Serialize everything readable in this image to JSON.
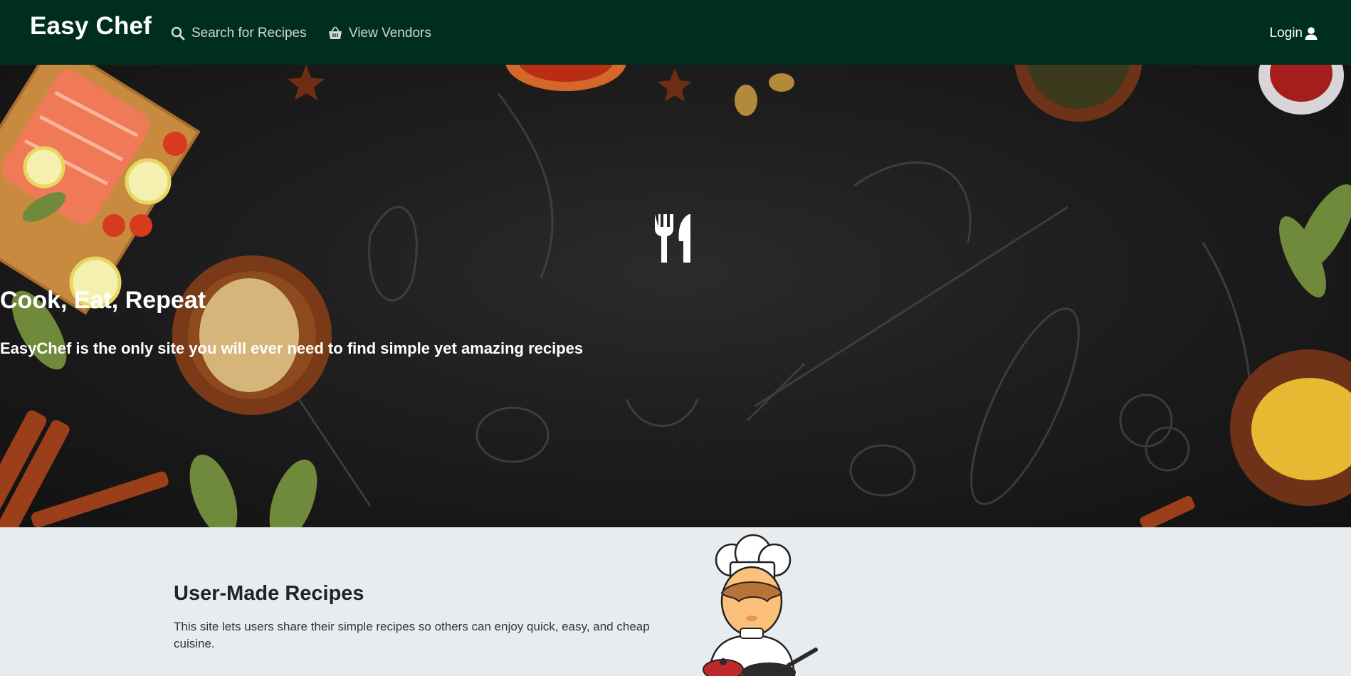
{
  "navbar": {
    "brand": "Easy Chef",
    "links": [
      {
        "label": "Search for Recipes",
        "icon": "search-icon"
      },
      {
        "label": "View Vendors",
        "icon": "basket-icon"
      }
    ],
    "login": {
      "label": "Login",
      "icon": "user-icon"
    }
  },
  "hero": {
    "icon": "utensils-icon",
    "title": "Cook, Eat, Repeat",
    "subtitle": "EasyChef is the only site you will ever need to find simple yet amazing recipes"
  },
  "section": {
    "title": "User-Made Recipes",
    "text": "This site lets users share their simple recipes so others can enjoy quick, easy, and cheap cuisine.",
    "illustration": "chef-illustration"
  },
  "colors": {
    "navbar_bg": "#002e1e",
    "hero_bg": "#1e1e1e",
    "section_bg": "#e9ecef"
  }
}
